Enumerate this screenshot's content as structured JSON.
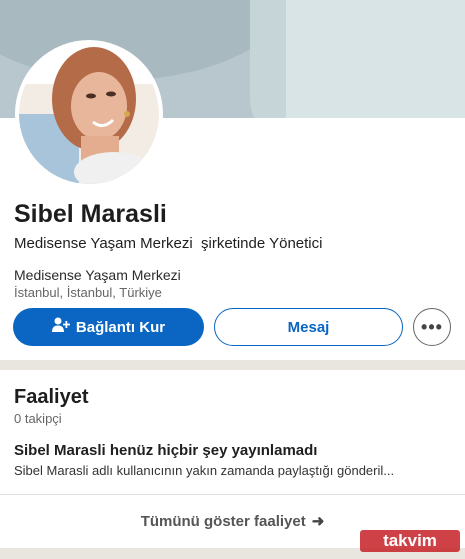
{
  "profile": {
    "name": "Sibel Marasli",
    "headline": "Medisense Yaşam Merkezi  şirketinde Yönetici",
    "company": "Medisense Yaşam Merkezi",
    "location": "İstanbul, İstanbul, Türkiye"
  },
  "actions": {
    "connect_label": "Bağlantı Kur",
    "connect_icon": "add-person-icon",
    "message_label": "Mesaj",
    "more_label": "•••"
  },
  "activity": {
    "title": "Faaliyet",
    "followers": "0 takipçi",
    "empty_title": "Sibel Marasli henüz hiçbir şey yayınlamadı",
    "empty_text": "Sibel Marasli adlı kullanıcının yakın zamanda paylaştığı gönderil...",
    "show_all": "Tümünü göster faaliyet",
    "show_all_icon": "arrow-right-icon"
  },
  "watermark": "takvim",
  "colors": {
    "primary": "#0a66c2",
    "divider": "#e9e5df",
    "cover": "#b7c7cd"
  }
}
